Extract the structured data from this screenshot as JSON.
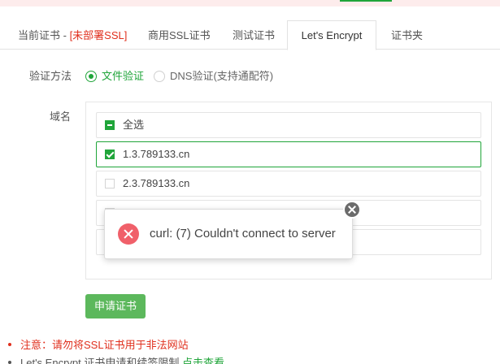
{
  "tabs": {
    "current_prefix": "当前证书 - ",
    "current_status": "[未部署SSL]",
    "commercial": "商用SSL证书",
    "test": "测试证书",
    "letsencrypt": "Let's Encrypt",
    "folder": "证书夹"
  },
  "verify": {
    "label": "验证方法",
    "option_file": "文件验证",
    "option_dns": "DNS验证(支持通配符)",
    "selected": "文件验证"
  },
  "domains": {
    "label": "域名",
    "select_all": "全选",
    "items": [
      {
        "name": "1.3.789133.cn",
        "checked": true
      },
      {
        "name": "2.3.789133.cn",
        "checked": false
      },
      {
        "name": "",
        "checked": false
      },
      {
        "name": "",
        "checked": false
      }
    ]
  },
  "apply_button": "申请证书",
  "notes": {
    "warning": "注意：请勿将SSL证书用于非法网站",
    "info_prefix": "Let's Encrypt 证书申请和续签限制",
    "info_link": "点击查看"
  },
  "toast": {
    "message": "curl: (7) Couldn't connect to server",
    "type": "error"
  },
  "colors": {
    "accent": "#20a53a",
    "warning": "#e0301e",
    "error_icon": "#f0606a",
    "button": "#5cb85c"
  }
}
